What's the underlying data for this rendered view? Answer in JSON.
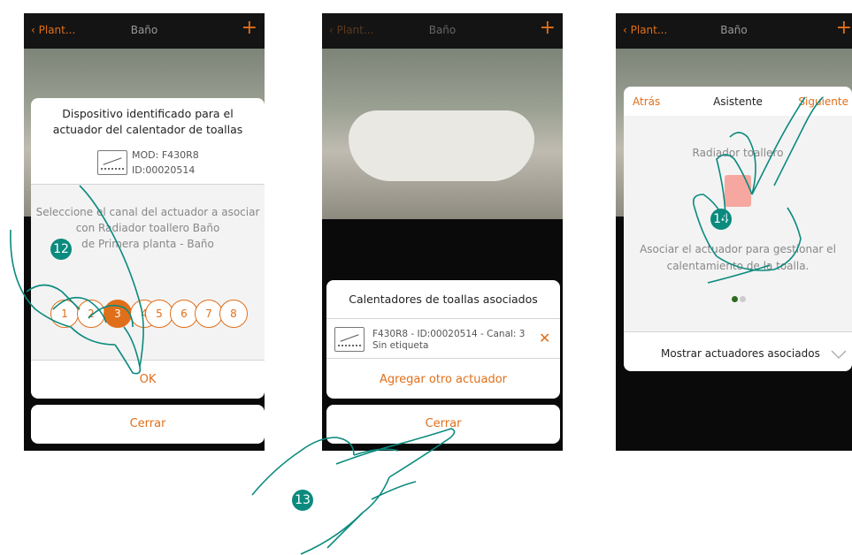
{
  "screen1": {
    "back_label": "Plant...",
    "title": "Baño",
    "plus": "+",
    "dialog_title": "Dispositivo identificado para el actuador del calentador de toallas",
    "mod": "MOD: F430R8",
    "id": "ID:00020514",
    "instruction_line1": "Seleccione el canal del actuador a asociar",
    "instruction_line2": "con Radiador toallero Baño",
    "instruction_line3": "de Primera planta - Baño",
    "channels": [
      "1",
      "2",
      "3",
      "4",
      "5",
      "6",
      "7",
      "8"
    ],
    "ok_label": "OK",
    "close_label": "Cerrar",
    "step": "12"
  },
  "screen2": {
    "back_label": "Plant...",
    "title": "Baño",
    "plus": "+",
    "dialog_title": "Calentadores de toallas asociados",
    "item_line1": "F430R8 - ID:00020514 - Canal: 3",
    "item_line2": "Sin etiqueta",
    "remove_symbol": "✕",
    "add_label": "Agregar otro actuador",
    "close_label": "Cerrar",
    "step": "13"
  },
  "screen3": {
    "back_label": "Plant...",
    "title": "Baño",
    "plus": "+",
    "header_back": "Atrás",
    "header_title": "Asistente",
    "header_next": "Siguiente",
    "device_name": "Radiador toallero",
    "description_line1": "Asociar el actuador para gestionar el",
    "description_line2": "calentamiento de la toalla.",
    "page_dots": 2,
    "active_dot": 1,
    "show_actuators_label": "Mostrar actuadores asociados",
    "step": "14"
  },
  "colors": {
    "accent": "#e06f1a",
    "badge": "#0b8a7e",
    "dot_active": "#2e6b1f",
    "dot_inactive": "#cccccc"
  },
  "icons": [
    "chevron-left-icon",
    "plus-icon",
    "actuator-device-icon",
    "close-x-icon",
    "towel-radiator-icon",
    "chevron-down-icon"
  ]
}
